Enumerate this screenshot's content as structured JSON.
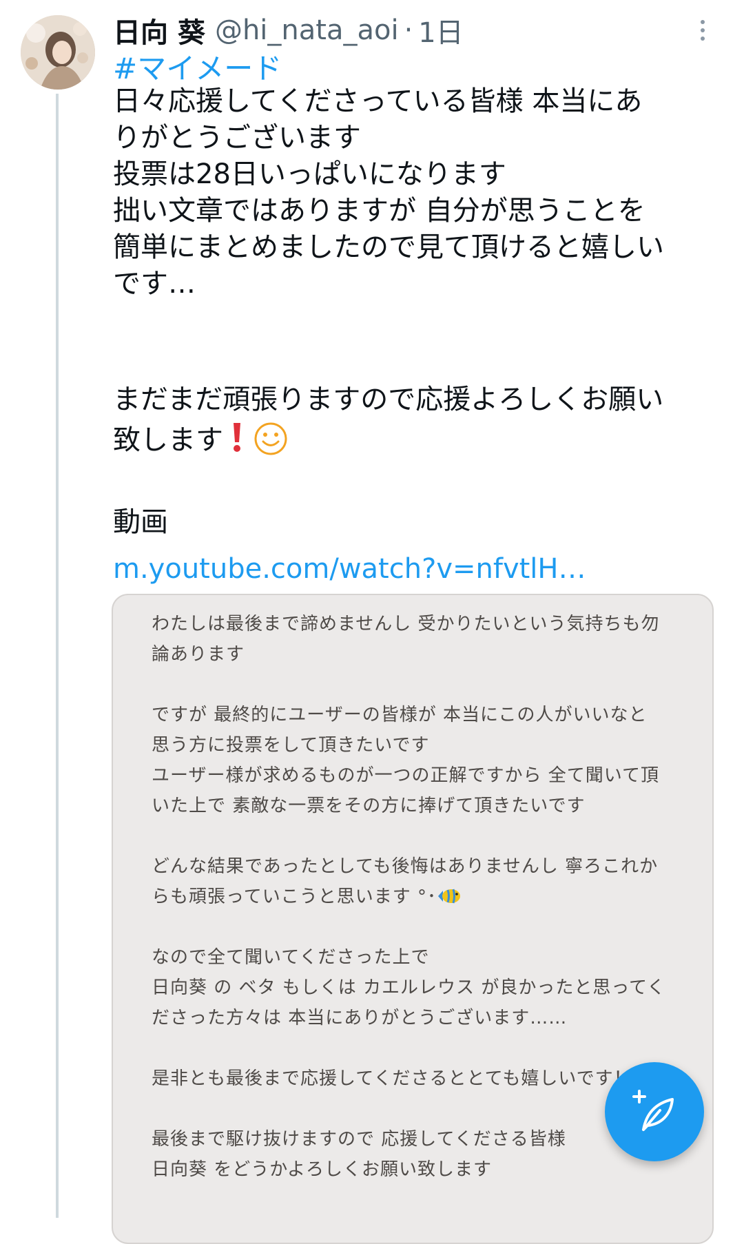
{
  "tweet": {
    "display_name": "日向 葵",
    "handle": "@hi_nata_aoi",
    "separator": "·",
    "time": "1日",
    "hashtag": "#マイメード",
    "lines": [
      "日々応援してくださっている皆様 本当にあ",
      "りがとうございます",
      "投票は28日いっぱいになります",
      "拙い文章ではありますが 自分が思うことを",
      "簡単にまとめましたので見て頂けると嬉しい",
      "です…",
      "まだまだ頑張りますので応援よろしくお願い",
      "致します",
      "動画"
    ],
    "link": "m.youtube.com/watch?v=nfvtlH…"
  },
  "image_text": {
    "lines": [
      "わたしは最後まで諦めませんし 受かりたいという気持ちも勿",
      "論あります",
      "ですが 最終的にユーザーの皆様が 本当にこの人がいいなと",
      "思う方に投票をして頂きたいです",
      "ユーザー様が求めるものが一つの正解ですから 全て聞いて頂",
      "いた上で 素敵な一票をその方に捧げて頂きたいです",
      "どんな結果であったとしても後悔はありませんし 寧ろこれか",
      "らも頑張っていこうと思います °･",
      "なので全て聞いてくださった上で",
      "日向葵 の ベタ もしくは カエルレウス が良かったと思ってく",
      "ださった方々は 本当にありがとうございます……",
      "是非とも最後まで応援してくださるととても嬉しいです！",
      "最後まで駆け抜けますので 応援してくださる皆様",
      "日向葵 をどうかよろしくお願い致します"
    ]
  },
  "icons": {
    "more": "more-vertical-icon",
    "compose": "compose-tweet-icon",
    "exclamation": "red-exclamation-emoji",
    "smile": "smiling-face-emoji",
    "fish": "tropical-fish-emoji"
  },
  "colors": {
    "accent": "#1d9bf0",
    "text": "#0f1419",
    "secondary": "#536471",
    "card_bg": "#eceae9"
  }
}
